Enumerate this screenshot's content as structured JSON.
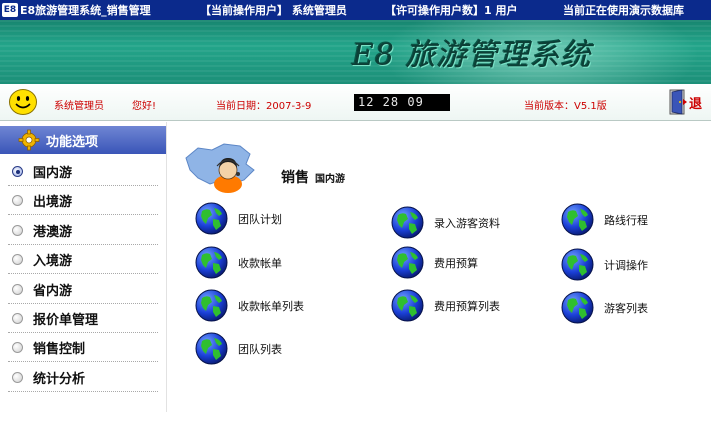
{
  "titlebar": {
    "app_icon_text": "E8",
    "app_title": "E8旅游管理系统_销售管理",
    "current_user": "【当前操作用户】 系统管理员",
    "license_count": "【许可操作用户数】1 用户",
    "db_status": "当前正在使用演示数据库"
  },
  "banner": {
    "brand": "E8 旅游管理系统"
  },
  "info": {
    "user_name": "系统管理员",
    "greeting": "您好!",
    "date_label": "当前日期：2007-3-9",
    "clock": "12 28 09",
    "version_label": "当前版本：V5.1版",
    "exit_label": "退"
  },
  "sidebar": {
    "title": "功能选项",
    "items": [
      {
        "label": "国内游",
        "selected": true
      },
      {
        "label": "出境游",
        "selected": false
      },
      {
        "label": "港澳游",
        "selected": false
      },
      {
        "label": "入境游",
        "selected": false
      },
      {
        "label": "省内游",
        "selected": false
      },
      {
        "label": "报价单管理",
        "selected": false
      },
      {
        "label": "销售控制",
        "selected": false
      },
      {
        "label": "统计分析",
        "selected": false
      }
    ]
  },
  "content": {
    "title": "销售",
    "subtitle": "国内游",
    "actions": [
      {
        "label": "团队计划",
        "icon": "globe-icon"
      },
      {
        "label": "录入游客资料",
        "icon": "globe-icon"
      },
      {
        "label": "路线行程",
        "icon": "globe-icon"
      },
      {
        "label": "收款帐单",
        "icon": "globe-icon"
      },
      {
        "label": "费用预算",
        "icon": "globe-icon"
      },
      {
        "label": "计调操作",
        "icon": "globe-icon"
      },
      {
        "label": "收款帐单列表",
        "icon": "globe-icon"
      },
      {
        "label": "费用预算列表",
        "icon": "globe-icon"
      },
      {
        "label": "游客列表",
        "icon": "globe-icon"
      },
      {
        "label": "团队列表",
        "icon": "globe-icon"
      }
    ]
  },
  "colors": {
    "titlebar_bg": "#0b2a8c",
    "banner_green": "#1c8f78",
    "info_red": "#cc0000",
    "sidebar_header_blue": "#3a55b8"
  }
}
